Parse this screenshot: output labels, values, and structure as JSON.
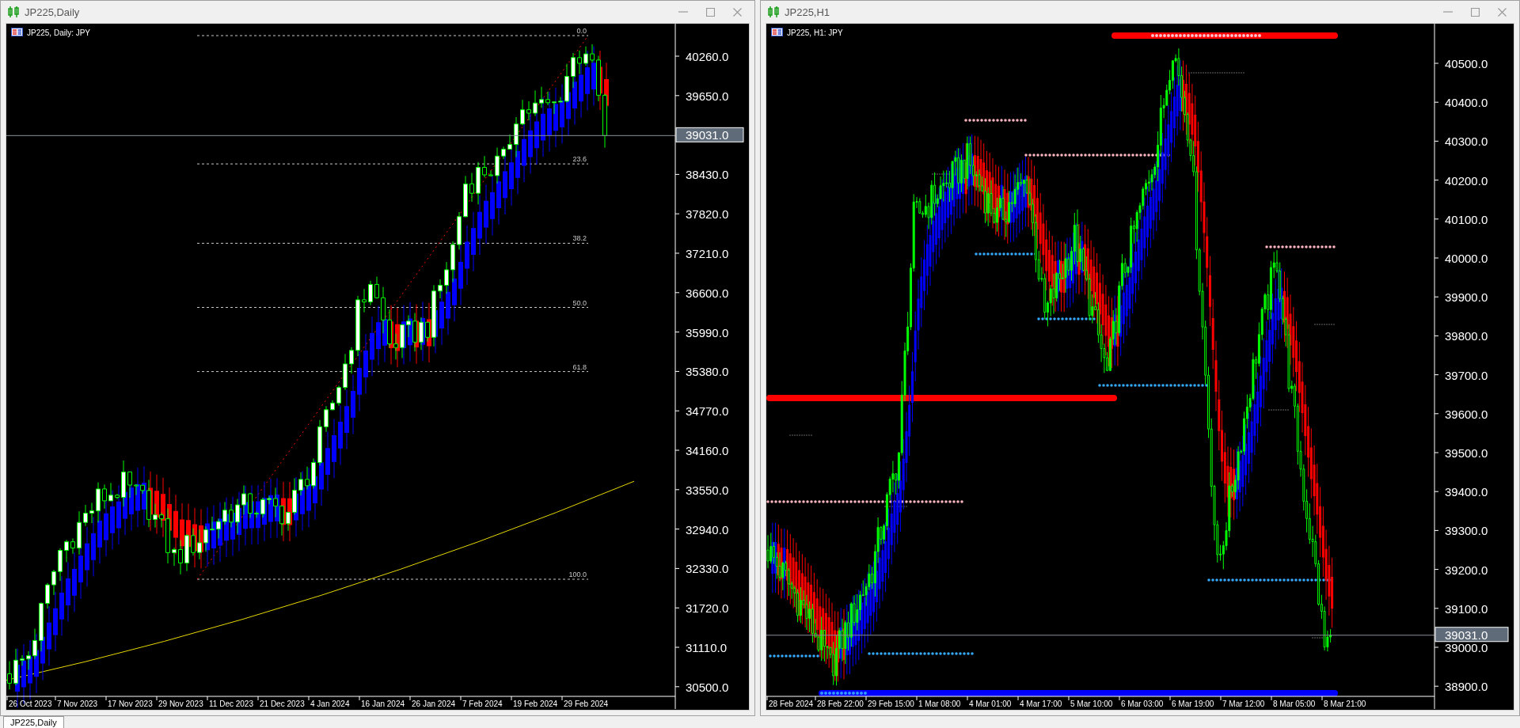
{
  "windows": [
    {
      "kind": "daily",
      "title": "JP225,Daily",
      "chart_label": "JP225, Daily:  JPY",
      "current_price": "39031.0",
      "price_labels": [
        "40260.0",
        "39650.0",
        "38430.0",
        "37820.0",
        "37210.0",
        "36600.0",
        "35990.0",
        "35380.0",
        "34770.0",
        "34160.0",
        "33550.0",
        "32940.0",
        "32330.0",
        "31720.0",
        "31110.0",
        "30500.0"
      ],
      "date_labels": [
        "26 Oct 2023",
        "7 Nov 2023",
        "17 Nov 2023",
        "29 Nov 2023",
        "11 Dec 2023",
        "21 Dec 2023",
        "4 Jan 2024",
        "16 Jan 2024",
        "26 Jan 2024",
        "7 Feb 2024",
        "19 Feb 2024",
        "29 Feb 2024"
      ],
      "fibonacci_labels": [
        "0.0",
        "23.6",
        "38.2",
        "50.0",
        "61.8",
        "100.0"
      ]
    },
    {
      "kind": "hourly",
      "title": "JP225,H1",
      "chart_label": "JP225, H1:  JPY",
      "current_price": "39031.0",
      "price_labels": [
        "40500.0",
        "40400.0",
        "40300.0",
        "40200.0",
        "40100.0",
        "40000.0",
        "39900.0",
        "39800.0",
        "39700.0",
        "39600.0",
        "39500.0",
        "39400.0",
        "39300.0",
        "39200.0",
        "39100.0",
        "39000.0",
        "38900.0"
      ],
      "date_labels": [
        "28 Feb 2024",
        "28 Feb 22:00",
        "29 Feb 15:00",
        "1 Mar 08:00",
        "4 Mar 01:00",
        "4 Mar 17:00",
        "5 Mar 10:00",
        "6 Mar 03:00",
        "6 Mar 19:00",
        "7 Mar 12:00",
        "8 Mar 05:00",
        "8 Mar 21:00"
      ]
    }
  ],
  "tabs": [
    {
      "label": "JP225,Daily",
      "selected": true
    }
  ]
}
